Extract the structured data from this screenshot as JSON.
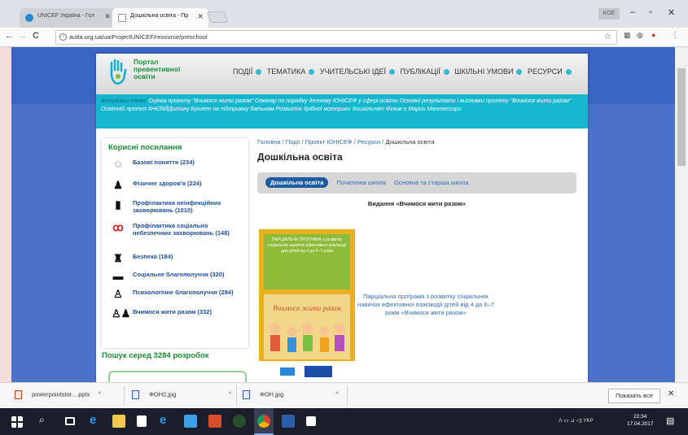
{
  "browser": {
    "tabs": [
      {
        "title": "UNICEF Україна - Гол",
        "active": false
      },
      {
        "title": "Дошкільна освіта - Пр",
        "active": true
      }
    ],
    "window_user": "KOE",
    "url": "autta.org.ua/ua/ProjectUNICEF/resourse/preschool",
    "nav": {
      "back": "←",
      "forward": "→",
      "reload": "C",
      "info": "i"
    }
  },
  "site": {
    "logo_text": "Портал превентивної освіти",
    "menu": [
      "ПОДІЇ",
      "ТЕМАТИКА",
      "УЧИТЕЛЬСЬКІ ІДЕЇ",
      "ПУБЛІКАЦІЇ",
      "ШКІЛЬНІ УМОВИ",
      "РЕСУРСИ"
    ],
    "ticker_label": "Актуальні теми:",
    "ticker_text": "Оцінка проекту \"Вчимося жити разом\"   Семінар по порядку денному ЮНІСЕФ у сфері освіти   Основні результати і висновки проекту \"Вчимося жити разом\"   Освітній проект #НЄбІЙДитину Буклет на підтримку батькам   Розвиток дрібної моторики дошкільнят   Фільм о Марии Монтессори",
    "sidebar": {
      "title": "Корисні посилання",
      "links": [
        {
          "label": "Базові поняття (234)",
          "icon": "baby-icon"
        },
        {
          "label": "Фізичне здоров'я (224)",
          "icon": "figure-icon"
        },
        {
          "label": "Профілактика неінфекційних захворювань (1010)",
          "icon": "bottle-icon"
        },
        {
          "label": "Профілактика соціально небезпечних захворювань (148)",
          "icon": "ribbon-icon"
        },
        {
          "label": "Безпека (184)",
          "icon": "shield-icon"
        },
        {
          "label": "Соціальне благополуччя (320)",
          "icon": "group-icon"
        },
        {
          "label": "Психологічне благополуччя (284)",
          "icon": "person-icon"
        },
        {
          "label": "Вчимося жити разом (332)",
          "icon": "pair-icon"
        }
      ],
      "search_title": "Пошук серед 3284 розробок",
      "search_value": ""
    },
    "content": {
      "breadcrumb": [
        "Головна",
        "Події",
        "Проект ЮНІСЕФ",
        "Ресурси",
        "Дошкільна освіта"
      ],
      "breadcrumb_sep": "/",
      "page_title": "Дошкільна освіта",
      "tabs": [
        "Дошкільна освіта",
        "Початкова школа",
        "Основна та старша школа"
      ],
      "subheading": "Видання «Вчимося жити разом»",
      "book_cover_text": "ПАРЦІАЛЬНА ПРОГРАМА з розвитку соціальних навичок ефективної взаємодії для дітей від 4 до 6–7 років",
      "book_cover_title": "Вчимося жити разом",
      "description": "Парціальна програма з розвитку соціальних навичок ефективної взаємодії дітей від 4 до 6–7 років «Вчимося жити разом»"
    }
  },
  "downloads": {
    "items": [
      "powerpointstor....pptx",
      "ФОН2.jpg",
      "ФОН.jpg"
    ],
    "show_all": "Показать все",
    "close": "✕"
  },
  "taskbar": {
    "tray_text": "ᐱ ▭ ⊿ ◁) УКР",
    "time": "22:34",
    "date": "17.04.2017"
  },
  "colors": {
    "accent": "#16b6cf",
    "green": "#1a8a33",
    "link": "#2e6db6",
    "page_bg": "#4a72c9"
  }
}
